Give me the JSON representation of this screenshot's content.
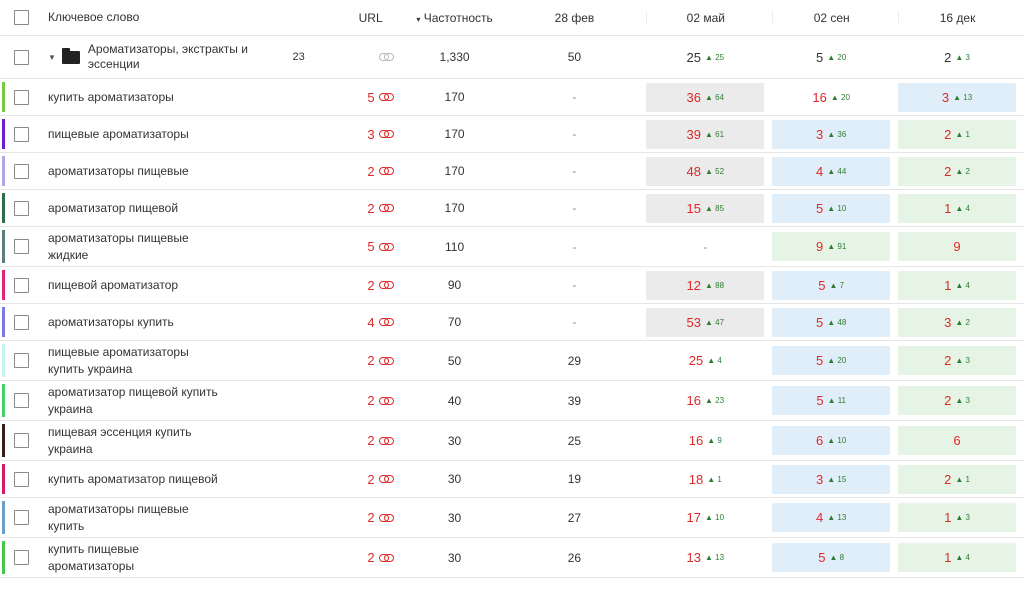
{
  "header": {
    "keyword": "Ключевое слово",
    "url": "URL",
    "sort_marker": "▾",
    "frequency": "Частотность",
    "dates": [
      "28 фев",
      "02 май",
      "02 сен",
      "16 дек"
    ]
  },
  "group": {
    "name_line1": "Ароматизаторы, экстракты и",
    "name_line2": "эссенции",
    "count": "23",
    "frequency": "1,330",
    "d1": "50",
    "pos": [
      {
        "v": "25",
        "d": "25"
      },
      {
        "v": "5",
        "d": "20"
      },
      {
        "v": "2",
        "d": "3"
      }
    ]
  },
  "colors": {
    "accent_red": "#e02828",
    "delta_green": "#2e7d32",
    "cell_gray": "#ebebeb",
    "cell_blue": "#e0eef9",
    "cell_green": "#e6f4e6"
  },
  "rows": [
    {
      "kw1": "купить ароматизаторы",
      "kw2": "",
      "url": "5",
      "freq": "170",
      "d1": "-",
      "p": [
        {
          "v": "36",
          "d": "64"
        },
        {
          "v": "16",
          "d": "20"
        },
        {
          "v": "3",
          "d": "13"
        }
      ]
    },
    {
      "kw1": "пищевые ароматизаторы",
      "kw2": "",
      "url": "3",
      "freq": "170",
      "d1": "-",
      "p": [
        {
          "v": "39",
          "d": "61"
        },
        {
          "v": "3",
          "d": "36"
        },
        {
          "v": "2",
          "d": "1"
        }
      ]
    },
    {
      "kw1": "ароматизаторы пищевые",
      "kw2": "",
      "url": "2",
      "freq": "170",
      "d1": "-",
      "p": [
        {
          "v": "48",
          "d": "52"
        },
        {
          "v": "4",
          "d": "44"
        },
        {
          "v": "2",
          "d": "2"
        }
      ]
    },
    {
      "kw1": "ароматизатор пищевой",
      "kw2": "",
      "url": "2",
      "freq": "170",
      "d1": "-",
      "p": [
        {
          "v": "15",
          "d": "85"
        },
        {
          "v": "5",
          "d": "10"
        },
        {
          "v": "1",
          "d": "4"
        }
      ]
    },
    {
      "kw1": "ароматизаторы пищевые",
      "kw2": "жидкие",
      "url": "5",
      "freq": "110",
      "d1": "-",
      "p": [
        {
          "v": "-",
          "d": ""
        },
        {
          "v": "9",
          "d": "91"
        },
        {
          "v": "9",
          "d": ""
        }
      ]
    },
    {
      "kw1": "пищевой ароматизатор",
      "kw2": "",
      "url": "2",
      "freq": "90",
      "d1": "-",
      "p": [
        {
          "v": "12",
          "d": "88"
        },
        {
          "v": "5",
          "d": "7"
        },
        {
          "v": "1",
          "d": "4"
        }
      ]
    },
    {
      "kw1": "ароматизаторы купить",
      "kw2": "",
      "url": "4",
      "freq": "70",
      "d1": "-",
      "p": [
        {
          "v": "53",
          "d": "47"
        },
        {
          "v": "5",
          "d": "48"
        },
        {
          "v": "3",
          "d": "2"
        }
      ]
    },
    {
      "kw1": "пищевые ароматизаторы",
      "kw2": "купить украина",
      "url": "2",
      "freq": "50",
      "d1": "29",
      "p": [
        {
          "v": "25",
          "d": "4"
        },
        {
          "v": "5",
          "d": "20"
        },
        {
          "v": "2",
          "d": "3"
        }
      ]
    },
    {
      "kw1": "ароматизатор пищевой купить",
      "kw2": "украина",
      "url": "2",
      "freq": "40",
      "d1": "39",
      "p": [
        {
          "v": "16",
          "d": "23"
        },
        {
          "v": "5",
          "d": "11"
        },
        {
          "v": "2",
          "d": "3"
        }
      ]
    },
    {
      "kw1": "пищевая эссенция купить",
      "kw2": "украина",
      "url": "2",
      "freq": "30",
      "d1": "25",
      "p": [
        {
          "v": "16",
          "d": "9"
        },
        {
          "v": "6",
          "d": "10"
        },
        {
          "v": "6",
          "d": ""
        }
      ]
    },
    {
      "kw1": "купить ароматизатор пищевой",
      "kw2": "",
      "url": "2",
      "freq": "30",
      "d1": "19",
      "p": [
        {
          "v": "18",
          "d": "1"
        },
        {
          "v": "3",
          "d": "15"
        },
        {
          "v": "2",
          "d": "1"
        }
      ]
    },
    {
      "kw1": "ароматизаторы пищевые",
      "kw2": "купить",
      "url": "2",
      "freq": "30",
      "d1": "27",
      "p": [
        {
          "v": "17",
          "d": "10"
        },
        {
          "v": "4",
          "d": "13"
        },
        {
          "v": "1",
          "d": "3"
        }
      ]
    },
    {
      "kw1": "купить пищевые",
      "kw2": "ароматизаторы",
      "url": "2",
      "freq": "30",
      "d1": "26",
      "p": [
        {
          "v": "13",
          "d": "13"
        },
        {
          "v": "5",
          "d": "8"
        },
        {
          "v": "1",
          "d": "4"
        }
      ]
    }
  ]
}
